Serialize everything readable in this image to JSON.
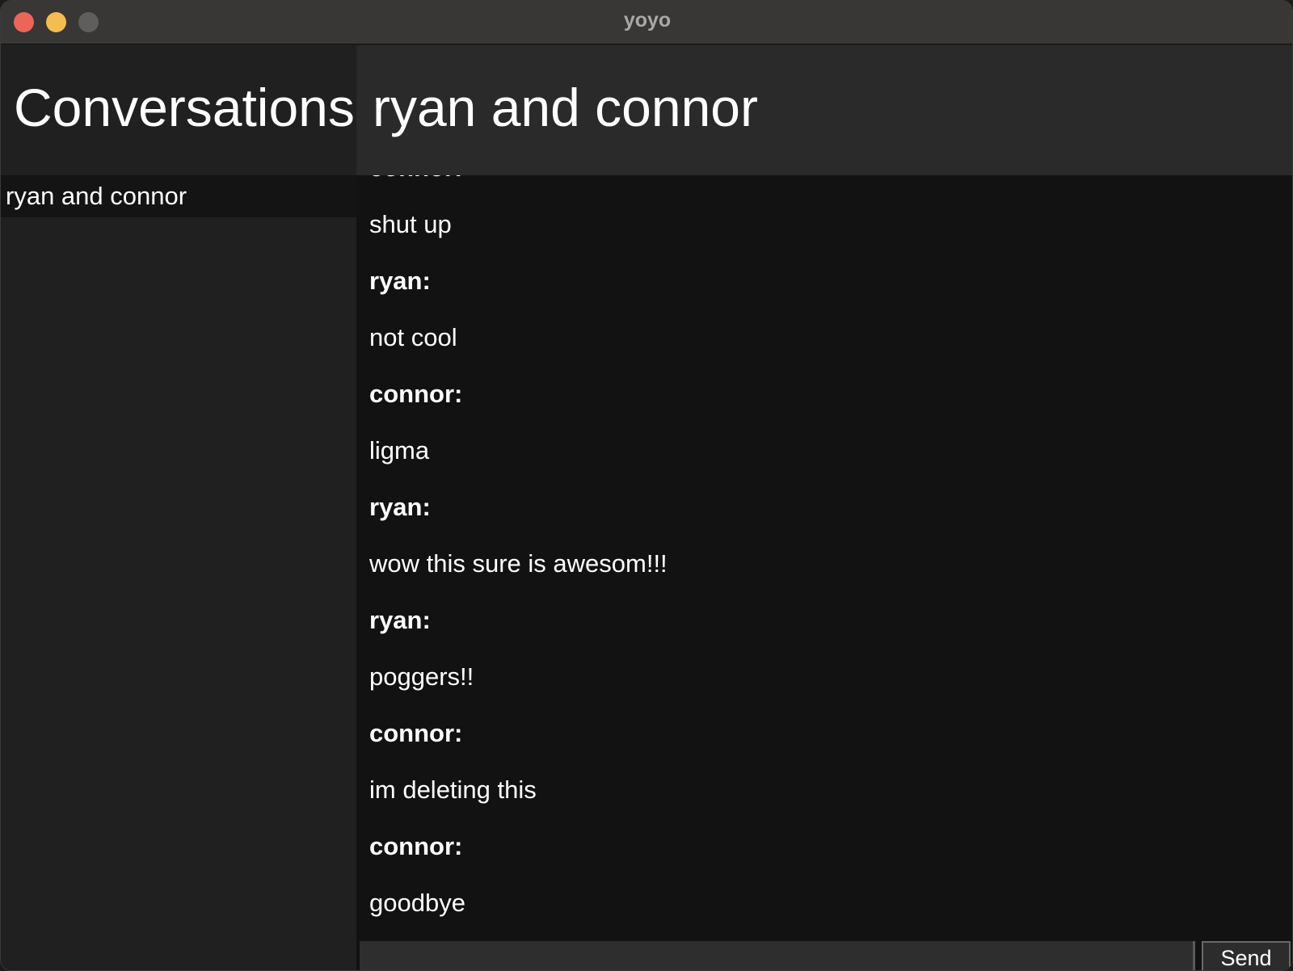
{
  "window": {
    "title": "yoyo"
  },
  "sidebar": {
    "header": "Conversations",
    "conversations": [
      {
        "label": "ryan and connor",
        "selected": true
      }
    ]
  },
  "chat": {
    "title": "ryan and connor",
    "messages": [
      {
        "sender": "connor:",
        "text": "shut up"
      },
      {
        "sender": "ryan:",
        "text": "not cool"
      },
      {
        "sender": "connor:",
        "text": "ligma"
      },
      {
        "sender": "ryan:",
        "text": "wow this sure is awesom!!!"
      },
      {
        "sender": "ryan:",
        "text": "poggers!!"
      },
      {
        "sender": "connor:",
        "text": "im deleting this"
      },
      {
        "sender": "connor:",
        "text": "goodbye"
      }
    ]
  },
  "composer": {
    "input_value": "",
    "send_label": "Send"
  }
}
